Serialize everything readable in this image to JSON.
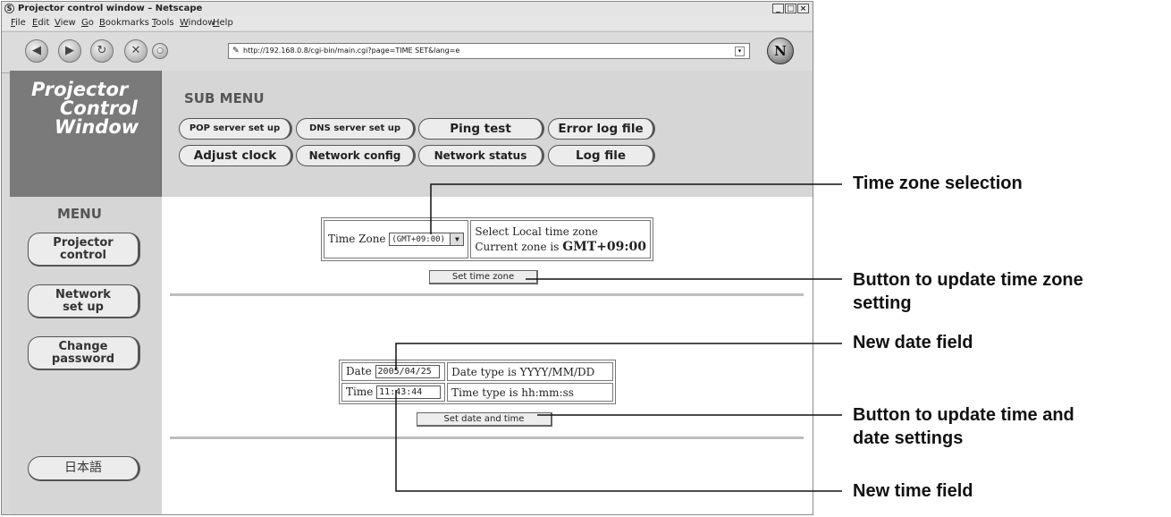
{
  "window": {
    "title": "Projector control window – Netscape"
  },
  "menubar": [
    "File",
    "Edit",
    "View",
    "Go",
    "Bookmarks",
    "Tools",
    "Window",
    "Help"
  ],
  "address": {
    "url": "http://192.168.0.8/cgi-bin/main.cgi?page=TIME SET&lang=e"
  },
  "logo": [
    "Projector",
    "Control",
    "Window"
  ],
  "submenu": {
    "title": "SUB MENU",
    "row1": [
      "POP server set up",
      "DNS server set up",
      "Ping test",
      "Error log file"
    ],
    "row2": [
      "Adjust clock",
      "Network config",
      "Network status",
      "Log file"
    ]
  },
  "menu": {
    "title": "MENU",
    "projector_control": [
      "Projector",
      "control"
    ],
    "network_setup": [
      "Network",
      "set up"
    ],
    "change_password": [
      "Change",
      "password"
    ],
    "japanese": "日本語"
  },
  "timezone": {
    "label": "Time Zone",
    "value": "(GMT+09:00)",
    "hint": "Select Local time zone",
    "current_prefix": "Current zone is",
    "current_value": "GMT+09:00",
    "button": "Set time zone"
  },
  "datetime": {
    "date_label": "Date",
    "date_value": "2005/04/25",
    "date_hint": "Date type is YYYY/MM/DD",
    "time_label": "Time",
    "time_value": "11:43:44",
    "time_hint": "Time type is hh:mm:ss",
    "button": "Set date and time"
  },
  "annotations": {
    "tz_selection": "Time zone selection",
    "tz_button": [
      "Button to update time zone",
      "setting"
    ],
    "new_date": "New date field",
    "dt_button": [
      "Button to update time and",
      "date settings"
    ],
    "new_time": "New time field"
  }
}
